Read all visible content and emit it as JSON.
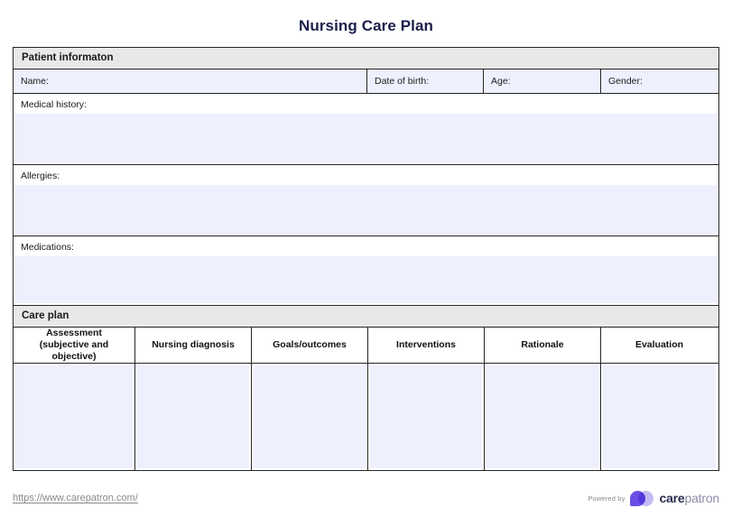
{
  "document": {
    "title": "Nursing Care Plan"
  },
  "patient_information": {
    "section_label": "Patient informaton",
    "fields": [
      {
        "label": "Name:",
        "value": ""
      },
      {
        "label": "Date of birth:",
        "value": ""
      },
      {
        "label": "Age:",
        "value": ""
      },
      {
        "label": "Gender:",
        "value": ""
      }
    ],
    "blocks": [
      {
        "label": "Medical history:",
        "value": ""
      },
      {
        "label": "Allergies:",
        "value": ""
      },
      {
        "label": "Medications:",
        "value": ""
      }
    ]
  },
  "care_plan": {
    "section_label": "Care plan",
    "columns": [
      {
        "line1": "Assessment",
        "line2": "(subjective and objective)",
        "value": ""
      },
      {
        "line1": "Nursing diagnosis",
        "line2": "",
        "value": ""
      },
      {
        "line1": "Goals/outcomes",
        "line2": "",
        "value": ""
      },
      {
        "line1": "Interventions",
        "line2": "",
        "value": ""
      },
      {
        "line1": "Rationale",
        "line2": "",
        "value": ""
      },
      {
        "line1": "Evaluation",
        "line2": "",
        "value": ""
      }
    ]
  },
  "footer": {
    "url": "https://www.carepatron.com/",
    "powered_by": "Powered by",
    "brand_first": "care",
    "brand_second": "patron"
  },
  "colors": {
    "title": "#1a1f4b",
    "field_fill": "#eef0fd",
    "section_header": "#e8e8e8",
    "border": "#262626",
    "brand_purple": "#6b4de6",
    "brand_lavender": "#bfb4f2",
    "muted_text": "#8a8a8a"
  }
}
